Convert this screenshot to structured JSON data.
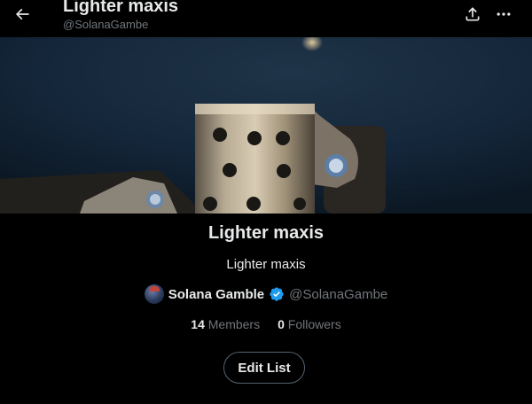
{
  "header": {
    "title": "Lighter maxis",
    "handle": "@SolanaGambe",
    "back_icon": "arrow-left-icon",
    "share_icon": "share-icon",
    "more_icon": "more-horizontal-icon"
  },
  "list": {
    "name": "Lighter maxis",
    "description": "Lighter maxis",
    "owner": {
      "name": "Solana Gamble",
      "handle": "@SolanaGambe",
      "verified_icon": "verified-badge-icon"
    },
    "stats": {
      "members_count": "14",
      "members_label": "Members",
      "followers_count": "0",
      "followers_label": "Followers"
    },
    "edit_button_label": "Edit List"
  },
  "colors": {
    "background": "#000000",
    "primary_text": "#e7e9ea",
    "secondary_text": "#71767b",
    "verified_blue": "#1d9bf0",
    "button_border": "#536471"
  }
}
